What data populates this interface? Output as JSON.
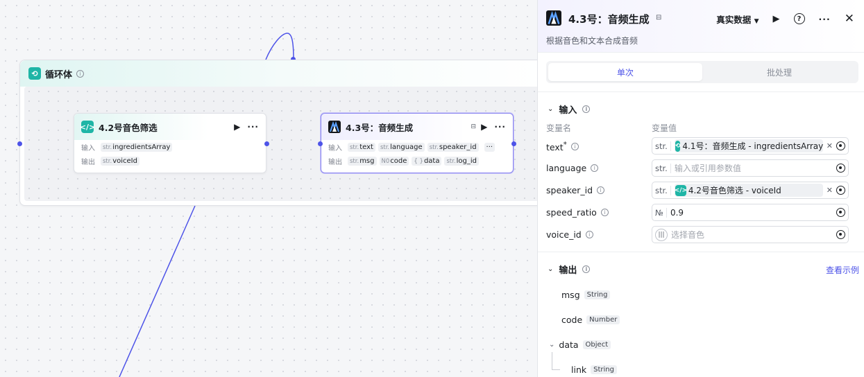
{
  "loop": {
    "title": "循环体"
  },
  "node_filter": {
    "title": "4.2号音色筛选",
    "input_label": "输入",
    "output_label": "输出",
    "inputs": [
      {
        "type": "str.",
        "name": "ingredientsArray"
      }
    ],
    "outputs": [
      {
        "type": "str.",
        "name": "voiceId"
      }
    ]
  },
  "node_audio": {
    "title": "4.3号：音频生成",
    "input_label": "输入",
    "output_label": "输出",
    "inputs": [
      {
        "type": "str.",
        "name": "text"
      },
      {
        "type": "str.",
        "name": "language"
      },
      {
        "type": "str.",
        "name": "speaker_id"
      }
    ],
    "outputs": [
      {
        "type": "str.",
        "name": "msg"
      },
      {
        "type": "N0",
        "name": "code"
      },
      {
        "type": "{ }",
        "name": "data"
      },
      {
        "type": "str.",
        "name": "log_id"
      }
    ]
  },
  "panel": {
    "title": "4.3号：音频生成",
    "description": "根据音色和文本合成音频",
    "data_mode": "真实数据",
    "tabs": {
      "single": "单次",
      "batch": "批处理"
    },
    "input_section": "输入",
    "col_name": "变量名",
    "col_value": "变量值",
    "params": [
      {
        "name": "text",
        "required": "*",
        "type": "str.",
        "ref": "4.1号：音频生成 - ingredientsArray"
      },
      {
        "name": "language",
        "type": "str.",
        "placeholder": "输入或引用参数值"
      },
      {
        "name": "speaker_id",
        "type": "str.",
        "ref": "4.2号音色筛选 - voiceId"
      },
      {
        "name": "speed_ratio",
        "type": "№",
        "value": "0.9"
      },
      {
        "name": "voice_id",
        "placeholder": "选择音色"
      }
    ],
    "output_section": "输出",
    "view_example": "查看示例",
    "outputs": [
      {
        "name": "msg",
        "type": "String"
      },
      {
        "name": "code",
        "type": "Number"
      },
      {
        "name": "data",
        "type": "Object"
      },
      {
        "name": "link",
        "type": "String"
      }
    ]
  },
  "colors": {
    "accent": "#4d53e8",
    "teal": "#1fb5a6"
  }
}
